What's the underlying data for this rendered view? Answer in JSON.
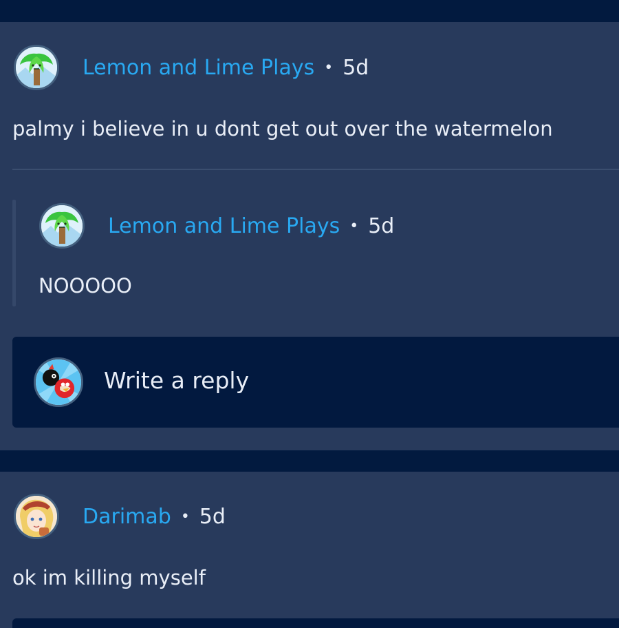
{
  "comments": [
    {
      "username": "Lemon and Lime Plays",
      "separator": "•",
      "time": "5d",
      "text": "palmy i believe in u dont get out over the watermelon",
      "avatar_icon": "palm-tree-avatar",
      "replies": [
        {
          "username": "Lemon and Lime Plays",
          "separator": "•",
          "time": "5d",
          "text": "NOOOOO",
          "avatar_icon": "palm-tree-avatar"
        }
      ],
      "reply_box": {
        "placeholder": "Write a reply",
        "avatar_icon": "angry-birds-avatar"
      }
    },
    {
      "username": "Darimab",
      "separator": "•",
      "time": "5d",
      "text": "ok im killing myself",
      "avatar_icon": "anime-girl-avatar"
    }
  ],
  "colors": {
    "background": "#021a3f",
    "card": "#283a5c",
    "username": "#29a9f2",
    "text": "#e9eef7"
  }
}
